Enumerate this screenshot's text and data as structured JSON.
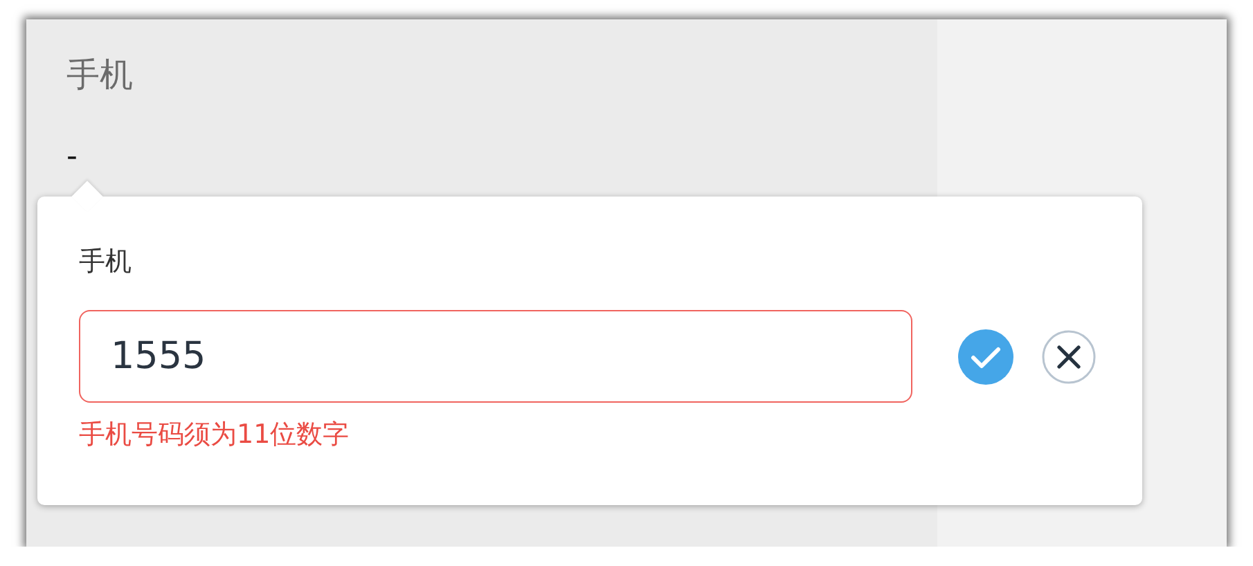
{
  "field": {
    "label": "手机",
    "value": "-"
  },
  "editor": {
    "label": "手机",
    "input_value": "1555",
    "invalid": true,
    "error": "手机号码须为11位数字"
  }
}
